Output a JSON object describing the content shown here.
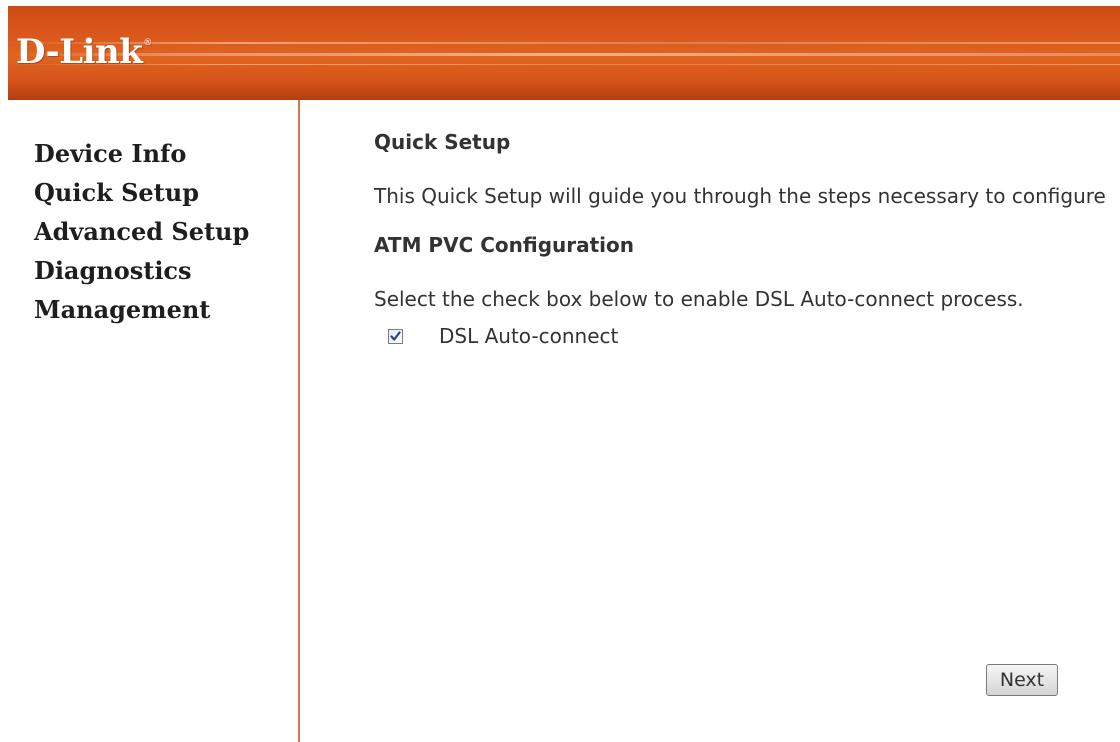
{
  "brand": {
    "logo_text": "D-Link",
    "registered_mark": "®"
  },
  "sidebar": {
    "items": [
      {
        "label": "Device Info"
      },
      {
        "label": "Quick Setup"
      },
      {
        "label": "Advanced Setup"
      },
      {
        "label": "Diagnostics"
      },
      {
        "label": "Management"
      }
    ]
  },
  "main": {
    "title": "Quick Setup",
    "description": "This Quick Setup will guide you through the steps necessary to configure",
    "section_title": "ATM PVC Configuration",
    "instruction": "Select the check box below to enable DSL Auto-connect process.",
    "auto_connect": {
      "label": "DSL Auto-connect",
      "checked": true
    },
    "next_label": "Next"
  },
  "colors": {
    "header_orange": "#d9571d",
    "sidebar_rule": "#cf7a4a",
    "text": "#333333",
    "nav_text": "#1e1e1e"
  },
  "icons": {
    "checkbox": "checkmark-icon"
  }
}
